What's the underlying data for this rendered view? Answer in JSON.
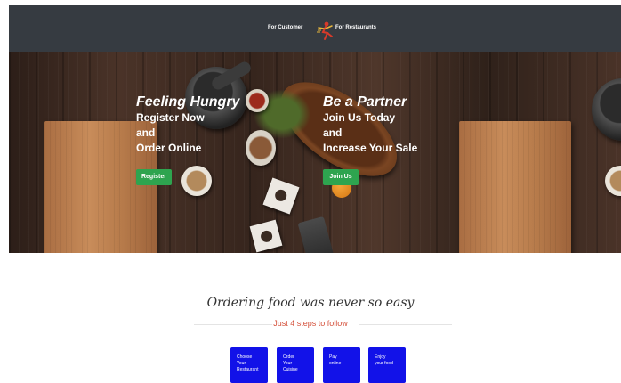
{
  "nav": {
    "customer_label": "For Customer",
    "restaurants_label": "For Restaurants",
    "logo_icon": "running-chef-logo-icon"
  },
  "hero": {
    "customer": {
      "heading": "Feeling Hungry",
      "line1": "Register Now",
      "line2": "and",
      "line3": "Order Online",
      "button": "Register"
    },
    "partner": {
      "heading": "Be a Partner",
      "line1": "Join Us Today",
      "line2": "and",
      "line3": "Increase Your Sale",
      "button": "Join Us"
    }
  },
  "steps": {
    "title": "Ordering food was never so easy",
    "subtitle": "Just 4 steps to follow",
    "items": [
      {
        "line1": "Choose",
        "line2": "Your",
        "line3": "Restaurant"
      },
      {
        "line1": "Order",
        "line2": "Your",
        "line3": "Cuisine"
      },
      {
        "line1": "Pay",
        "line2": "online",
        "line3": ""
      },
      {
        "line1": "Enjoy",
        "line2": "your food",
        "line3": ""
      }
    ]
  },
  "colors": {
    "topbar": "#363b41",
    "button_green": "#2ea44f",
    "step_blue": "#1212e8",
    "subtitle_red": "#d4503a"
  }
}
